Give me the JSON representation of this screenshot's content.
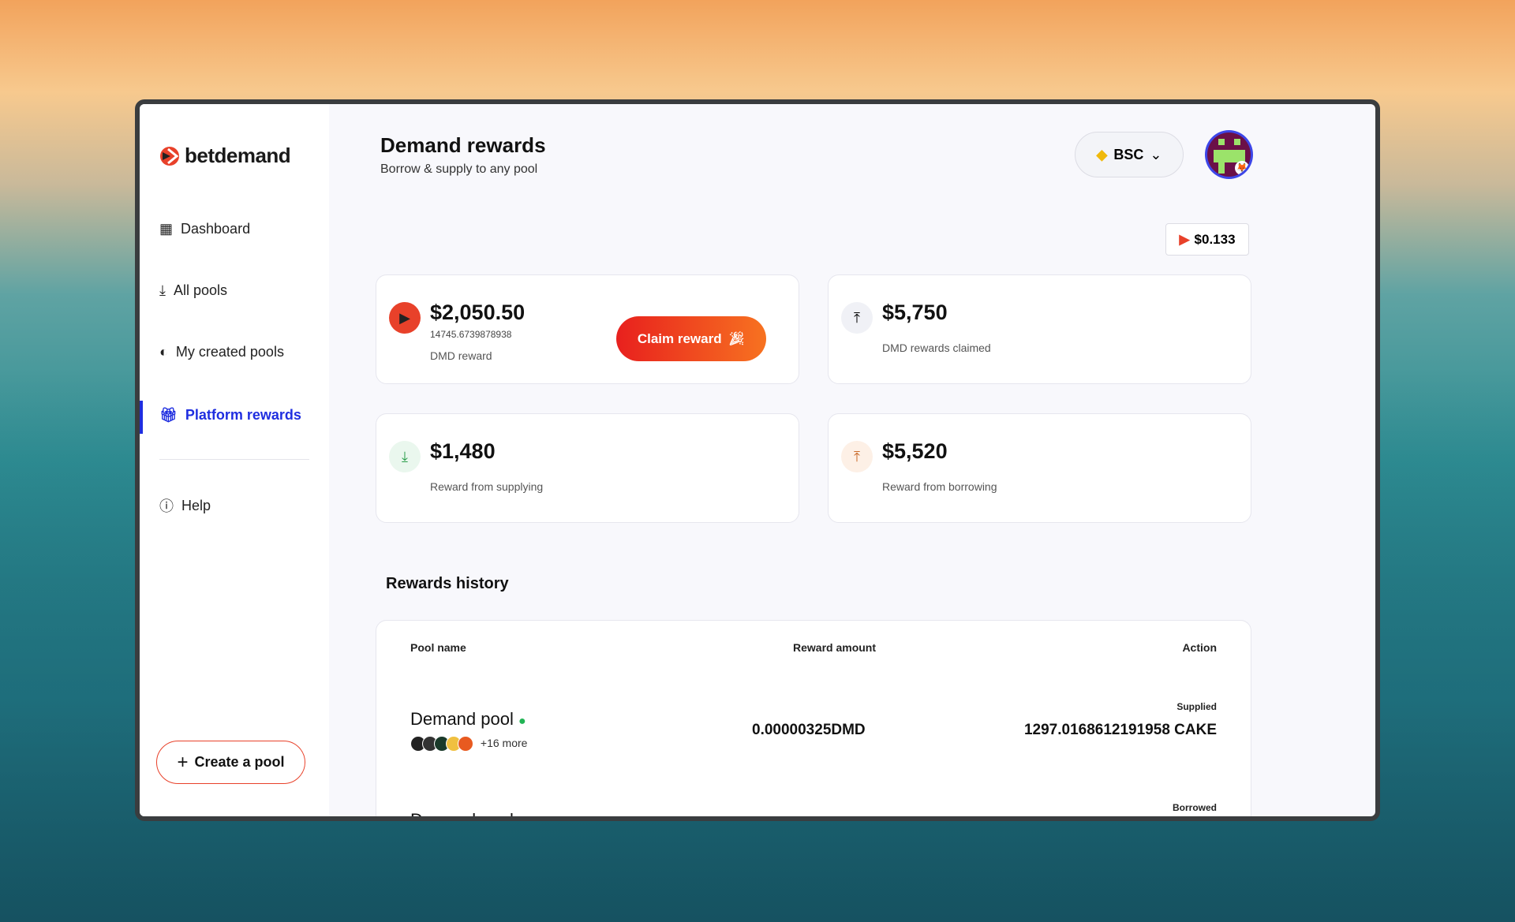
{
  "brand": {
    "name": "betdemand",
    "accent": "#e8412a",
    "active": "#1f2ee0"
  },
  "sidebar": {
    "items": [
      {
        "label": "Dashboard",
        "icon": "grid-icon"
      },
      {
        "label": "All pools",
        "icon": "download-tray-icon"
      },
      {
        "label": "My created pools",
        "icon": "half-circle-icon"
      },
      {
        "label": "Platform rewards",
        "icon": "gift-icon",
        "active": true
      },
      {
        "label": "Help",
        "icon": "help-circle-icon"
      }
    ],
    "create_label": "Create a pool"
  },
  "header": {
    "title": "Demand rewards",
    "subtitle": "Borrow & supply to any pool",
    "chain": "BSC",
    "token_price": "$0.133"
  },
  "cards": {
    "dmd": {
      "value": "$2,050.50",
      "amount": "14745.6739878938",
      "label": "DMD reward",
      "button": "Claim reward"
    },
    "claimed": {
      "value": "$5,750",
      "label": "DMD rewards claimed"
    },
    "supplying": {
      "value": "$1,480",
      "label": "Reward from supplying"
    },
    "borrowing": {
      "value": "$5,520",
      "label": "Reward from borrowing"
    }
  },
  "history": {
    "title": "Rewards history",
    "columns": [
      "Pool name",
      "Reward amount",
      "Action"
    ],
    "rows": [
      {
        "pool": "Demand pool",
        "more": "+16 more",
        "amount": "0.00000325DMD",
        "action_type": "Supplied",
        "action_value": "1297.0168612191958 CAKE"
      },
      {
        "pool": "Demand pool",
        "action_type": "Borrowed"
      }
    ]
  }
}
